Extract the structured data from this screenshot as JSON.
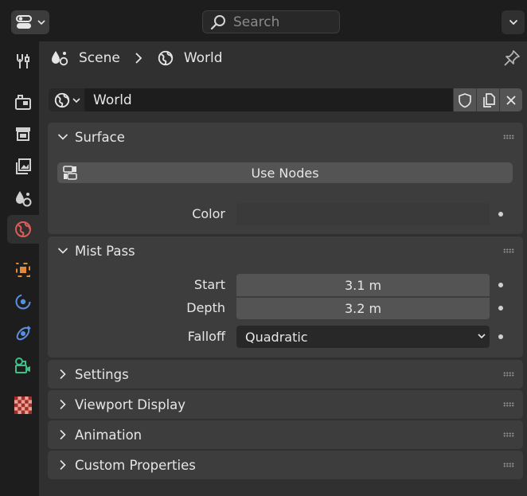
{
  "header": {
    "search_placeholder": "Search"
  },
  "tabs": [
    {
      "name": "tool"
    },
    {
      "name": "render"
    },
    {
      "name": "output"
    },
    {
      "name": "view-layer"
    },
    {
      "name": "scene"
    },
    {
      "name": "world",
      "active": true
    },
    {
      "name": "object"
    },
    {
      "name": "physics"
    },
    {
      "name": "constraints"
    },
    {
      "name": "data"
    },
    {
      "name": "texture"
    }
  ],
  "breadcrumb": {
    "scene_label": "Scene",
    "world_label": "World"
  },
  "datablock": {
    "name": "World"
  },
  "panels": {
    "surface": {
      "title": "Surface",
      "use_nodes_label": "Use Nodes",
      "color_label": "Color",
      "color_value": "#3a3a3a"
    },
    "mist": {
      "title": "Mist Pass",
      "start_label": "Start",
      "start_value": "3.1 m",
      "depth_label": "Depth",
      "depth_value": "3.2 m",
      "falloff_label": "Falloff",
      "falloff_value": "Quadratic"
    },
    "settings": {
      "title": "Settings"
    },
    "viewport_display": {
      "title": "Viewport Display"
    },
    "animation": {
      "title": "Animation"
    },
    "custom_properties": {
      "title": "Custom Properties"
    }
  },
  "colors": {
    "accent_world": "#e05a5a",
    "object_orange": "#e08a3c",
    "physics_blue": "#5a8fe0",
    "camera_green": "#3cc08a"
  }
}
